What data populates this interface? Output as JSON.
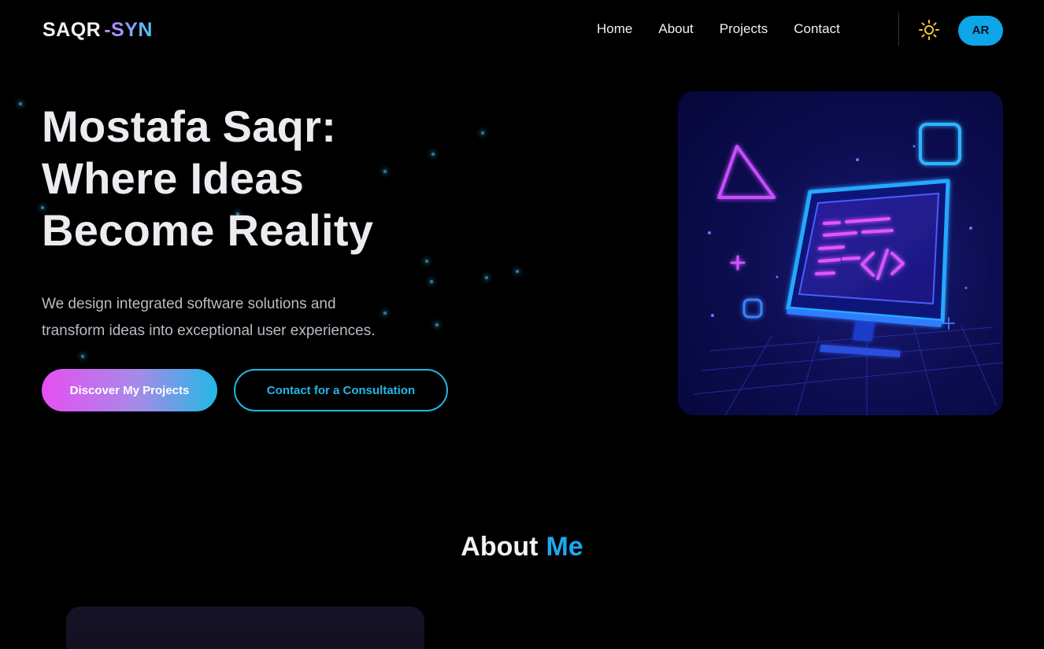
{
  "brand": {
    "name_part1": "SAQR",
    "name_part2": "-SYN"
  },
  "nav": {
    "links": [
      "Home",
      "About",
      "Projects",
      "Contact"
    ],
    "theme_icon": "sun-icon",
    "language_label": "AR"
  },
  "hero": {
    "title_lines": [
      "Mostafa Saqr:",
      "Where Ideas",
      "Become Reality"
    ],
    "subtitle_lines": [
      "We design integrated software solutions and",
      "transform ideas into exceptional user experiences."
    ],
    "primary_button": "Discover My Projects",
    "secondary_button": "Contact for a Consultation",
    "illustration_icon": "computer-code-illustration"
  },
  "about": {
    "title_part1": "About",
    "title_part2": "Me"
  },
  "colors": {
    "accent_blue": "#1ea7f0",
    "accent_pink": "#e64ff2",
    "accent_cyan": "#22b8e6",
    "sun": "#f4c430"
  }
}
